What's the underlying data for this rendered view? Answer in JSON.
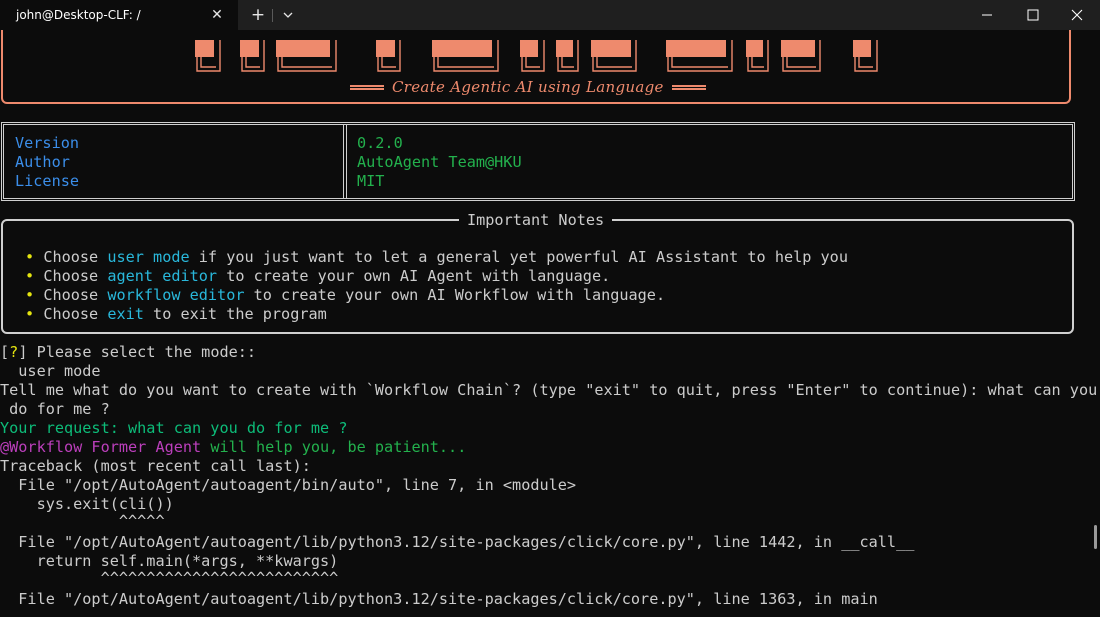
{
  "window": {
    "tab_title": "john@Desktop-CLF: /",
    "icons": {
      "close_tab": "close-icon",
      "new_tab": "plus-icon",
      "dropdown": "chevron-down-icon",
      "minimize": "minimize-icon",
      "maximize": "maximize-icon",
      "close_window": "close-icon"
    }
  },
  "banner": {
    "subtitle": "Create Agentic AI using Language",
    "accent_color": "#ee8a6d"
  },
  "info": {
    "rows": [
      {
        "key": "Version",
        "value": "0.2.0"
      },
      {
        "key": "Author",
        "value": "AutoAgent Team@HKU"
      },
      {
        "key": "License",
        "value": "MIT"
      }
    ]
  },
  "notes": {
    "title": "Important Notes",
    "bullet": "•",
    "items": [
      {
        "pre": "Choose ",
        "hl": "user mode",
        "post": " if you just want to let a general yet powerful AI Assistant to help you"
      },
      {
        "pre": "Choose ",
        "hl": "agent editor",
        "post": " to create your own AI Agent with language."
      },
      {
        "pre": "Choose ",
        "hl": "workflow editor",
        "post": " to create your own AI Workflow with language."
      },
      {
        "pre": "Choose ",
        "hl": "exit",
        "post": " to exit the program"
      }
    ]
  },
  "session": {
    "prompt_open": "[",
    "prompt_q": "?",
    "prompt_close": "] Please select the mode::",
    "selected": "  user mode",
    "question_1": "Tell me what do you want to create with `Workflow Chain`? (type \"exit\" to quit, press \"Enter\" to continue): what can you",
    "question_2": " do for me ?",
    "request": "Your request: what can you do for me ?",
    "agent_name": "@Workflow Former Agent",
    "agent_msg": " will help you, be patient..."
  },
  "traceback": [
    "Traceback (most recent call last):",
    "  File \"/opt/AutoAgent/autoagent/bin/auto\", line 7, in <module>",
    "    sys.exit(cli())",
    "             ^^^^^",
    "  File \"/opt/AutoAgent/autoagent/lib/python3.12/site-packages/click/core.py\", line 1442, in __call__",
    "    return self.main(*args, **kwargs)",
    "           ^^^^^^^^^^^^^^^^^^^^^^^^^^",
    "  File \"/opt/AutoAgent/autoagent/lib/python3.12/site-packages/click/core.py\", line 1363, in main"
  ]
}
